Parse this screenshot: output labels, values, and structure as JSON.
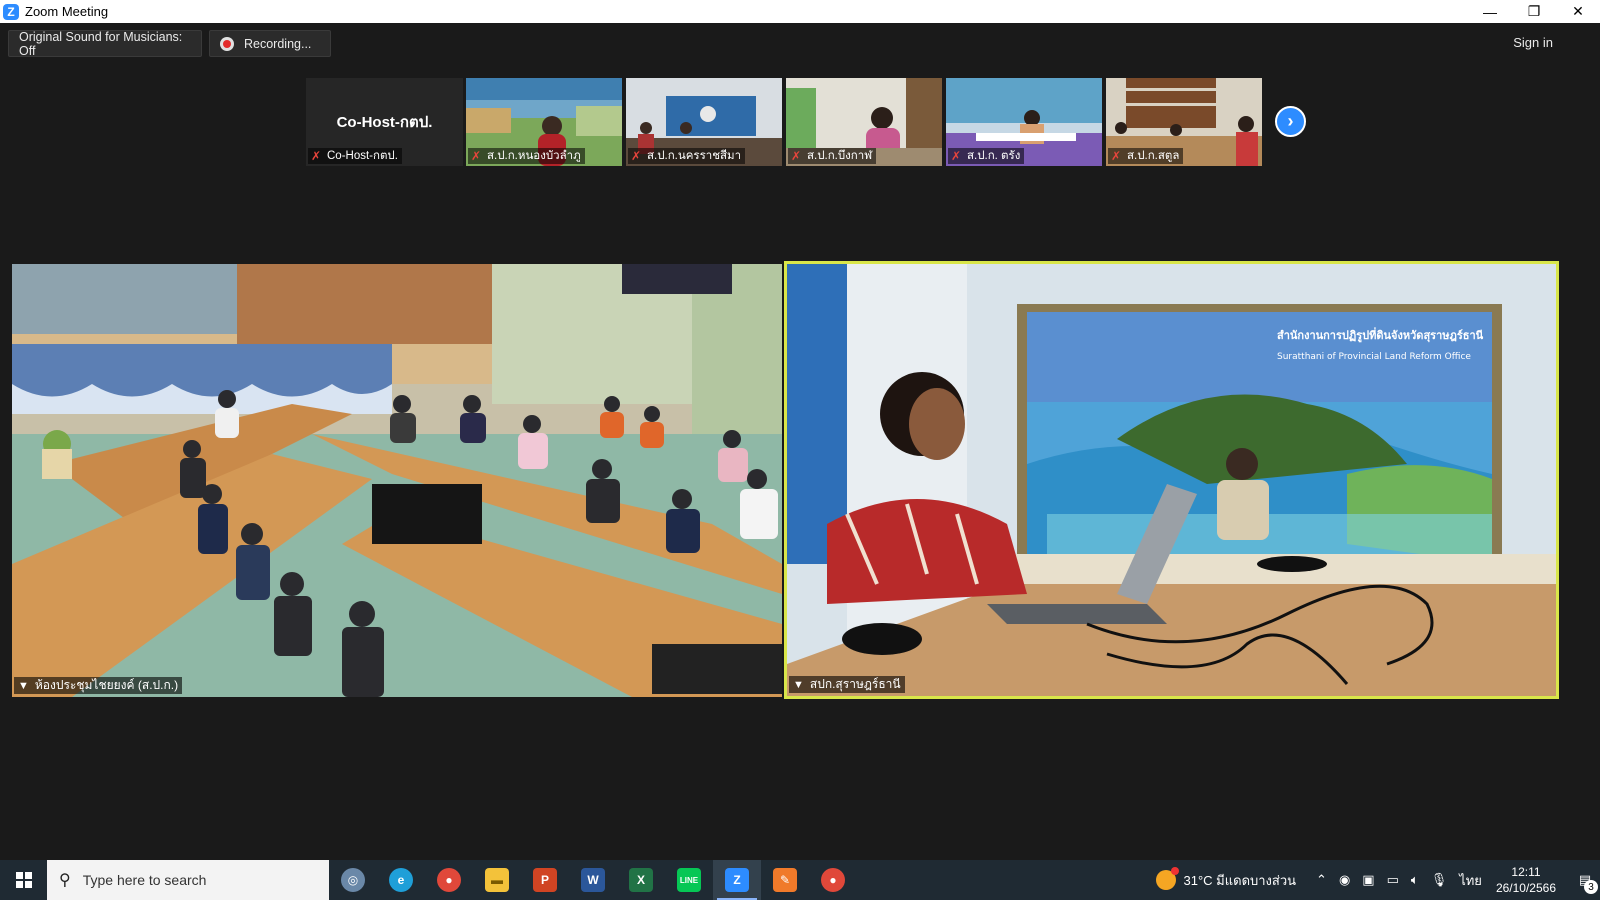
{
  "window": {
    "title": "Zoom Meeting",
    "minimize": "—",
    "restore": "❐",
    "close": "✕"
  },
  "toolbar": {
    "original_sound": "Original Sound for Musicians: Off",
    "recording": "Recording...",
    "sign_in": "Sign in"
  },
  "thumbnails": [
    {
      "name": "Co-Host-กตป.",
      "display_name": "Co-Host-กตป.",
      "type": "name-only"
    },
    {
      "name": "ส.ป.ก.หนองบัวลำภู",
      "type": "video"
    },
    {
      "name": "ส.ป.ก.นครราชสีมา",
      "type": "video"
    },
    {
      "name": "ส.ป.ก.บึงกาฬ",
      "type": "video"
    },
    {
      "name": "ส.ป.ก. ตรัง",
      "type": "video"
    },
    {
      "name": "ส.ป.ก.สตูล",
      "type": "video"
    }
  ],
  "next_page_icon": "›",
  "main_tiles": {
    "left": {
      "name": "ห้องประชุมไชยยงค์ (ส.ป.ก.)"
    },
    "right": {
      "name": "สปก.สุราษฎร์ธานี",
      "active_speaker": true,
      "banner_thai": "สำนักงานการปฏิรูปที่ดินจังหวัดสุราษฎร์ธานี",
      "banner_en": "Suratthani of Provincial Land Reform Office"
    }
  },
  "taskbar": {
    "search_placeholder": "Type here to search",
    "apps": [
      "cortana",
      "edge",
      "chrome",
      "file-explorer",
      "powerpoint",
      "word",
      "excel",
      "line",
      "zoom",
      "paint",
      "chrome-profile"
    ],
    "weather": "31°C  มีแดดบางส่วน",
    "language": "ไทย",
    "time": "12:11",
    "date": "26/10/2566",
    "notifications": "3"
  },
  "colors": {
    "active_speaker_border": "#d9e64a",
    "zoom_blue": "#2d8cff",
    "background": "#1a1a1a"
  }
}
